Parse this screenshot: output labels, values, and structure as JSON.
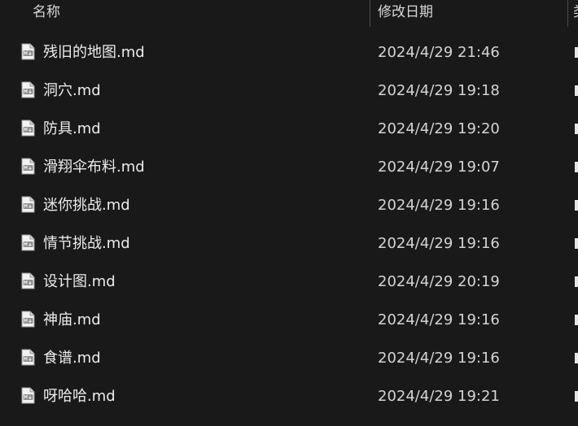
{
  "header": {
    "name_label": "名称",
    "date_label": "修改日期",
    "type_label": "类"
  },
  "icon": "markdown-file-icon",
  "files": [
    {
      "name": "残旧的地图.md",
      "modified": "2024/4/29 21:46"
    },
    {
      "name": "洞穴.md",
      "modified": "2024/4/29 19:18"
    },
    {
      "name": "防具.md",
      "modified": "2024/4/29 19:20"
    },
    {
      "name": "滑翔伞布料.md",
      "modified": "2024/4/29 19:07"
    },
    {
      "name": "迷你挑战.md",
      "modified": "2024/4/29 19:16"
    },
    {
      "name": "情节挑战.md",
      "modified": "2024/4/29 19:16"
    },
    {
      "name": "设计图.md",
      "modified": "2024/4/29 20:19"
    },
    {
      "name": "神庙.md",
      "modified": "2024/4/29 19:16"
    },
    {
      "name": "食谱.md",
      "modified": "2024/4/29 19:16"
    },
    {
      "name": "呀哈哈.md",
      "modified": "2024/4/29 19:21"
    }
  ]
}
